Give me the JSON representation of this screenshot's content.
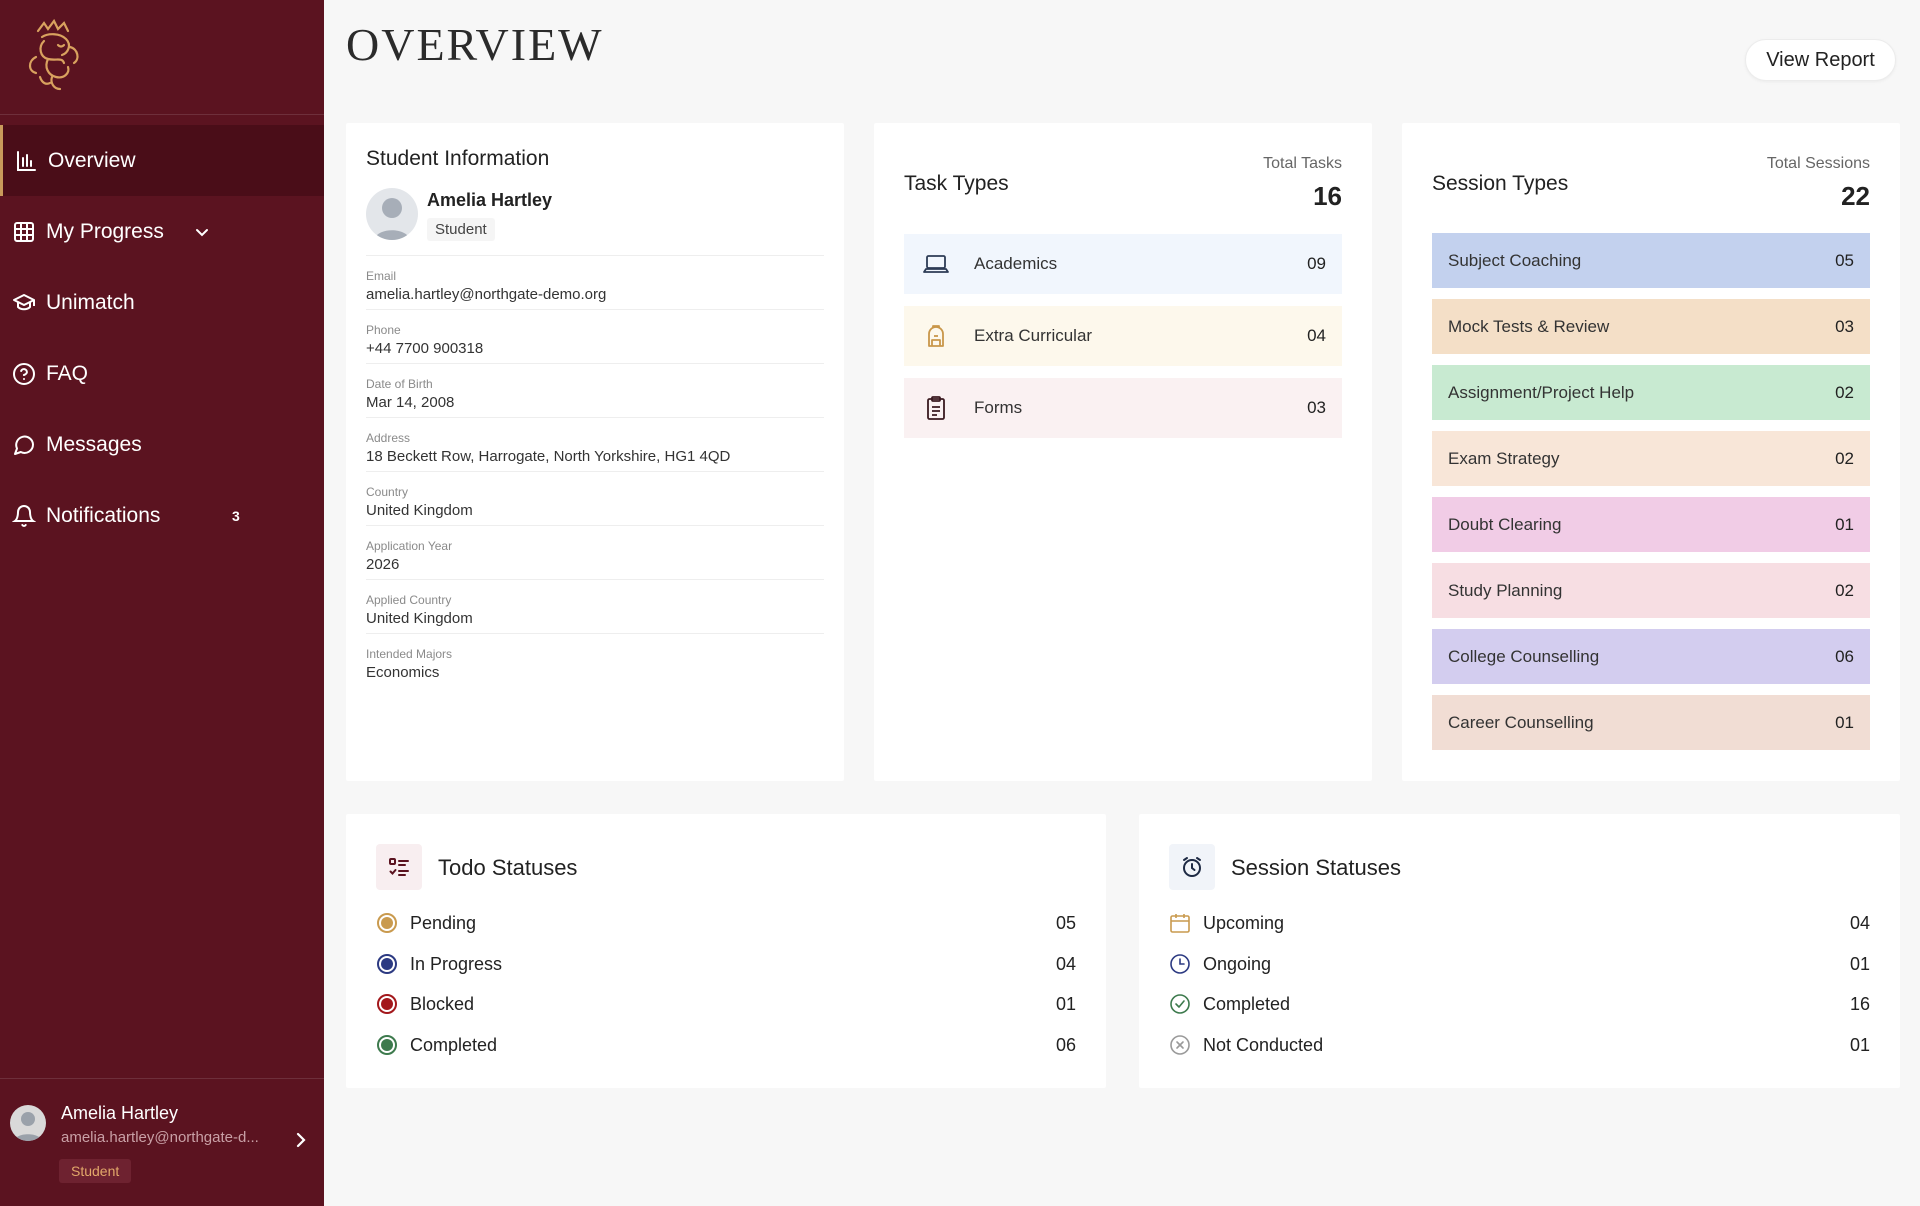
{
  "page": {
    "title": "OVERVIEW",
    "view_report_label": "View Report"
  },
  "sidebar": {
    "items": [
      {
        "label": "Overview",
        "icon": "bar-chart-icon",
        "active": true
      },
      {
        "label": "My Progress",
        "icon": "grid-icon"
      },
      {
        "label": "Unimatch",
        "icon": "graduation-cap-icon"
      },
      {
        "label": "FAQ",
        "icon": "help-circle-icon"
      },
      {
        "label": "Messages",
        "icon": "chat-bubble-icon"
      },
      {
        "label": "Notifications",
        "icon": "bell-icon",
        "badge": "3"
      }
    ],
    "user": {
      "name": "Amelia Hartley",
      "email": "amelia.hartley@northgate-d...",
      "role": "Student"
    }
  },
  "student": {
    "title": "Student Information",
    "name": "Amelia Hartley",
    "role": "Student",
    "fields": [
      {
        "label": "Email",
        "value": "amelia.hartley@northgate-demo.org"
      },
      {
        "label": "Phone",
        "value": "+44 7700 900318"
      },
      {
        "label": "Date of Birth",
        "value": "Mar 14, 2008"
      },
      {
        "label": "Address",
        "value": "18 Beckett Row, Harrogate, North Yorkshire, HG1 4QD"
      },
      {
        "label": "Country",
        "value": "United Kingdom"
      },
      {
        "label": "Application Year",
        "value": "2026"
      },
      {
        "label": "Applied Country",
        "value": "United Kingdom"
      },
      {
        "label": "Intended Majors",
        "value": "Economics"
      }
    ]
  },
  "tasks": {
    "title": "Task Types",
    "total_label": "Total Tasks",
    "total": "16",
    "items": [
      {
        "label": "Academics",
        "value": "09",
        "icon": "laptop-icon",
        "bg": "#f1f6fd"
      },
      {
        "label": "Extra Curricular",
        "value": "04",
        "icon": "backpack-icon",
        "bg": "#fdf8ec"
      },
      {
        "label": "Forms",
        "value": "03",
        "icon": "clipboard-icon",
        "bg": "#faf1f2"
      }
    ]
  },
  "sessions": {
    "title": "Session Types",
    "total_label": "Total Sessions",
    "total": "22",
    "items": [
      {
        "label": "Subject Coaching",
        "value": "05",
        "bg": "#c3d1ee"
      },
      {
        "label": "Mock Tests & Review",
        "value": "03",
        "bg": "#f4dfc7"
      },
      {
        "label": "Assignment/Project Help",
        "value": "02",
        "bg": "#c8ead1"
      },
      {
        "label": "Exam Strategy",
        "value": "02",
        "bg": "#f8e6d8"
      },
      {
        "label": "Doubt Clearing",
        "value": "01",
        "bg": "#f1cce6"
      },
      {
        "label": "Study Planning",
        "value": "02",
        "bg": "#f7dee3"
      },
      {
        "label": "College Counselling",
        "value": "06",
        "bg": "#d3cdef"
      },
      {
        "label": "Career Counselling",
        "value": "01",
        "bg": "#f1ddd4"
      }
    ]
  },
  "todo": {
    "title": "Todo Statuses",
    "items": [
      {
        "label": "Pending",
        "value": "05",
        "color": "#c99a4e"
      },
      {
        "label": "In Progress",
        "value": "04",
        "color": "#2c3a82"
      },
      {
        "label": "Blocked",
        "value": "01",
        "color": "#a3181c"
      },
      {
        "label": "Completed",
        "value": "06",
        "color": "#3d7a4d"
      }
    ]
  },
  "session_status": {
    "title": "Session Statuses",
    "items": [
      {
        "label": "Upcoming",
        "value": "04",
        "icon": "calendar-icon"
      },
      {
        "label": "Ongoing",
        "value": "01",
        "icon": "clock-icon"
      },
      {
        "label": "Completed",
        "value": "16",
        "icon": "check-circle-icon"
      },
      {
        "label": "Not Conducted",
        "value": "01",
        "icon": "x-circle-icon"
      }
    ]
  }
}
